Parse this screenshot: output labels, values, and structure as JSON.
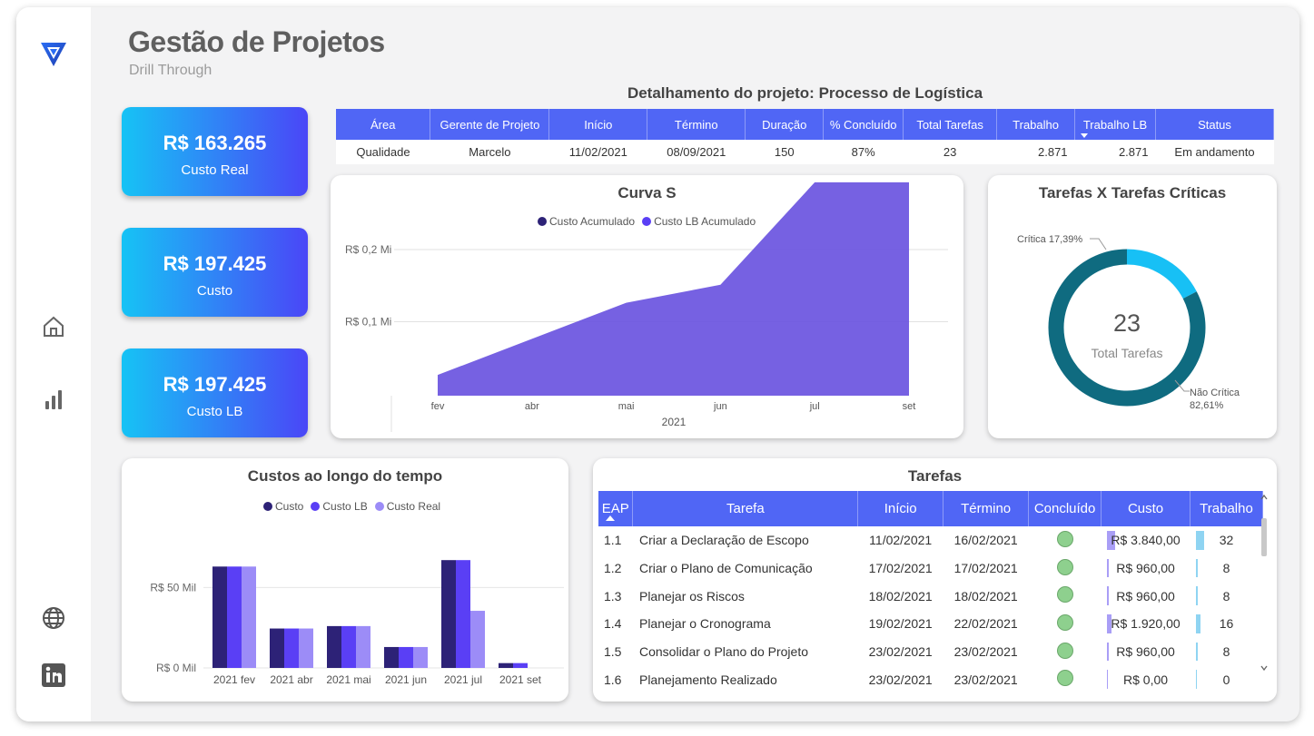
{
  "header": {
    "title": "Gestão de Projetos",
    "subtitle": "Drill Through"
  },
  "sidebar": {
    "icons": [
      "logo-icon",
      "home-icon",
      "bar-chart-icon",
      "globe-icon",
      "linkedin-icon"
    ]
  },
  "kpis": [
    {
      "value": "R$ 163.265",
      "label": "Custo Real"
    },
    {
      "value": "R$ 197.425",
      "label": "Custo"
    },
    {
      "value": "R$ 197.425",
      "label": "Custo LB"
    }
  ],
  "detail": {
    "title": "Detalhamento do projeto: Processo de Logística",
    "headers": [
      "Área",
      "Gerente de Projeto",
      "Início",
      "Término",
      "Duração",
      "% Concluído",
      "Total Tarefas",
      "Trabalho",
      "Trabalho LB",
      "Status"
    ],
    "row": [
      "Qualidade",
      "Marcelo",
      "11/02/2021",
      "08/09/2021",
      "150",
      "87%",
      "23",
      "2.871",
      "2.871",
      "Em andamento"
    ]
  },
  "colors": {
    "dark": "#2d2277",
    "mid": "#5a3ff5",
    "light": "#9c8cf7",
    "area": "#6a54e0",
    "donut_main": "#0f6b80",
    "donut_crit": "#17c0f5",
    "header_blue": "#5066f5"
  },
  "chart_data": [
    {
      "type": "area",
      "title": "Curva S",
      "legend": [
        "Custo Acumulado",
        "Custo LB Acumulado"
      ],
      "x": [
        "fev",
        "abr",
        "mai",
        "jun",
        "jul",
        "set"
      ],
      "xlabel": "2021",
      "y_ticks": [
        "R$ 0,1 Mi",
        "R$ 0,2 Mi"
      ],
      "series": [
        {
          "name": "Custo LB Acumulado",
          "values": [
            0.03,
            0.08,
            0.13,
            0.155,
            0.297,
            0.297
          ]
        }
      ],
      "ylim": [
        0,
        0.2
      ]
    },
    {
      "type": "pie",
      "title": "Tarefas X Tarefas Críticas",
      "center_value": "23",
      "center_label": "Total Tarefas",
      "slices": [
        {
          "label": "Crítica",
          "pct_label": "Crítica 17,39%",
          "value": 17.39
        },
        {
          "label": "Não Crítica",
          "pct_label": "Não Crítica",
          "pct_text": "82,61%",
          "value": 82.61
        }
      ]
    },
    {
      "type": "bar",
      "title": "Custos ao longo do tempo",
      "categories": [
        "2021 fev",
        "2021 abr",
        "2021 mai",
        "2021 jun",
        "2021 jul",
        "2021 set"
      ],
      "series": [
        {
          "name": "Custo",
          "values": [
            63,
            24.5,
            26,
            13,
            67,
            3
          ]
        },
        {
          "name": "Custo LB",
          "values": [
            63,
            24.5,
            26,
            13,
            67,
            3
          ]
        },
        {
          "name": "Custo Real",
          "values": [
            63,
            24.5,
            26,
            13,
            35.5,
            0
          ]
        }
      ],
      "y_ticks": [
        "R$ 0 Mil",
        "R$ 50 Mil"
      ],
      "ylim": [
        0,
        75
      ]
    }
  ],
  "tasks": {
    "title": "Tarefas",
    "headers": [
      "EAP",
      "Tarefa",
      "Início",
      "Término",
      "Concluído",
      "Custo",
      "Trabalho"
    ],
    "rows": [
      {
        "eap": "1.1",
        "tarefa": "Criar a Declaração de Escopo",
        "inicio": "11/02/2021",
        "termino": "16/02/2021",
        "custo": "R$ 3.840,00",
        "trabalho": "32",
        "custo_frac": 0.11,
        "trab_frac": 0.11
      },
      {
        "eap": "1.2",
        "tarefa": "Criar o Plano de Comunicação",
        "inicio": "17/02/2021",
        "termino": "17/02/2021",
        "custo": "R$ 960,00",
        "trabalho": "8",
        "custo_frac": 0.03,
        "trab_frac": 0.03
      },
      {
        "eap": "1.3",
        "tarefa": "Planejar os Riscos",
        "inicio": "18/02/2021",
        "termino": "18/02/2021",
        "custo": "R$ 960,00",
        "trabalho": "8",
        "custo_frac": 0.03,
        "trab_frac": 0.03
      },
      {
        "eap": "1.4",
        "tarefa": "Planejar o Cronograma",
        "inicio": "19/02/2021",
        "termino": "22/02/2021",
        "custo": "R$ 1.920,00",
        "trabalho": "16",
        "custo_frac": 0.06,
        "trab_frac": 0.06
      },
      {
        "eap": "1.5",
        "tarefa": "Consolidar o Plano do Projeto",
        "inicio": "23/02/2021",
        "termino": "23/02/2021",
        "custo": "R$ 960,00",
        "trabalho": "8",
        "custo_frac": 0.03,
        "trab_frac": 0.03
      },
      {
        "eap": "1.6",
        "tarefa": "Planejamento Realizado",
        "inicio": "23/02/2021",
        "termino": "23/02/2021",
        "custo": "R$ 0,00",
        "trabalho": "0",
        "custo_frac": 0,
        "trab_frac": 0
      }
    ]
  }
}
